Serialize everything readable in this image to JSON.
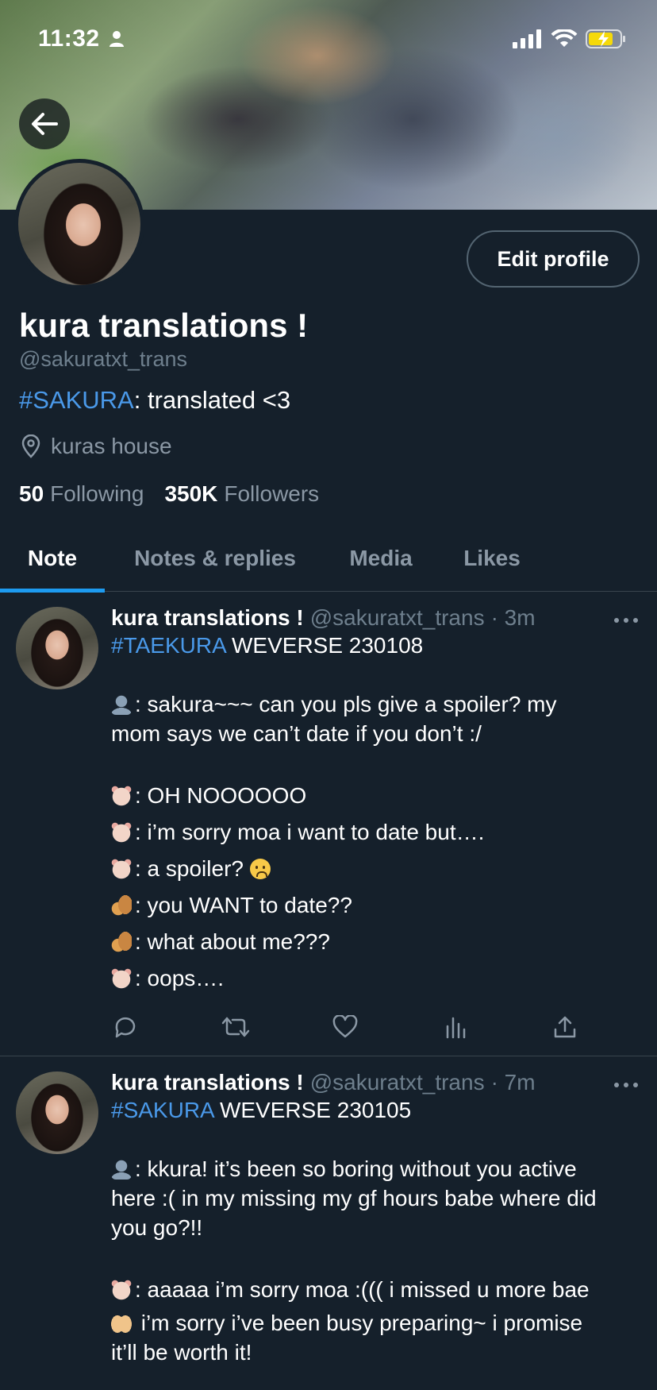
{
  "status_bar": {
    "time": "11:32"
  },
  "profile": {
    "display_name": "kura translations !",
    "handle": "@sakuratxt_trans",
    "bio_hashtag": "#SAKURA",
    "bio_text": ": translated <3",
    "location": "kuras house",
    "following_count": "50",
    "following_label": "Following",
    "followers_count": "350K",
    "followers_label": "Followers",
    "edit_profile_label": "Edit profile"
  },
  "tabs": [
    {
      "label": "Note",
      "active": true
    },
    {
      "label": "Notes & replies",
      "active": false
    },
    {
      "label": "Media",
      "active": false
    },
    {
      "label": "Likes",
      "active": false
    }
  ],
  "tweets": [
    {
      "name": "kura translations !",
      "handle": "@sakuratxt_trans",
      "time": "· 3m",
      "hashtag": "#TAEKURA",
      "heading": " WEVERSE 230108",
      "lines": [
        {
          "emoji": "person-emoji",
          "text": ": sakura~~~ can you pls give a spoiler? my"
        },
        {
          "emoji": "",
          "text": "mom says we can’t date if you don’t :/"
        },
        {
          "emoji": "hamster-emoji",
          "text": ": OH NOOOOOO"
        },
        {
          "emoji": "hamster-emoji",
          "text": ": i’m sorry moa i want to date but…."
        },
        {
          "emoji": "hamster-emoji",
          "text": ": a spoiler? "
        },
        {
          "emoji": "squirrel-emoji",
          "text": ": you WANT to date??"
        },
        {
          "emoji": "squirrel-emoji",
          "text": ": what about me???"
        },
        {
          "emoji": "hamster-emoji",
          "text": ": oops…."
        }
      ]
    },
    {
      "name": "kura translations !",
      "handle": "@sakuratxt_trans",
      "time": "· 7m",
      "hashtag": "#SAKURA",
      "heading": " WEVERSE 230105",
      "lines": [
        {
          "emoji": "person-emoji",
          "text": ": kkura! it’s been so boring without you active"
        },
        {
          "emoji": "",
          "text": "here :( in my missing my gf hours babe where did"
        },
        {
          "emoji": "",
          "text": "you go?!!"
        },
        {
          "emoji": "hamster-emoji",
          "text": ": aaaaa i’m sorry moa :((( i missed u more bae"
        },
        {
          "emoji": "hands-emoji",
          "text": " i’m sorry i’ve been busy preparing~ i promise"
        },
        {
          "emoji": "",
          "text": "it’ll be worth it!"
        }
      ]
    }
  ],
  "colors": {
    "background": "#15202b",
    "accent": "#1d9bf0",
    "hashtag": "#4a99e9",
    "muted": "#8b98a5",
    "border": "#38444d"
  }
}
